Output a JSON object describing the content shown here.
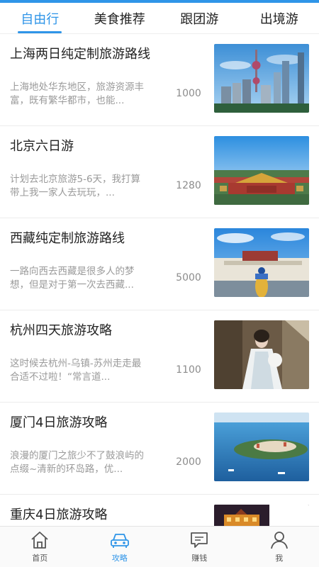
{
  "tabs": [
    {
      "label": "自由行",
      "active": true
    },
    {
      "label": "美食推荐",
      "active": false
    },
    {
      "label": "跟团游",
      "active": false
    },
    {
      "label": "出境游",
      "active": false
    }
  ],
  "items": [
    {
      "title": "上海两日纯定制旅游路线",
      "desc": "上海地处华东地区，旅游资源丰富，既有繁华都市，也能...",
      "count": "1000",
      "image": "shanghai-skyline"
    },
    {
      "title": "北京六日游",
      "desc": "计划去北京旅游5-6天，我打算带上我一家人去玩玩，...",
      "count": "1280",
      "image": "forbidden-city"
    },
    {
      "title": "西藏纯定制旅游路线",
      "desc": "一路向西去西藏是很多人的梦想，但是对于第一次去西藏...",
      "count": "5000",
      "image": "potala-palace"
    },
    {
      "title": "杭州四天旅游攻略",
      "desc": "这时候去杭州-乌镇-苏州走走最合适不过啦！“常言道...",
      "count": "1100",
      "image": "hanfu-girl"
    },
    {
      "title": "厦门4日旅游攻略",
      "desc": "浪漫的厦门之旅少不了鼓浪屿的点缀~清新的环岛路，优...",
      "count": "2000",
      "image": "xiamen-island"
    },
    {
      "title": "重庆4日旅游攻略",
      "desc": "",
      "count": "",
      "image": "chongqing-night"
    }
  ],
  "bottom_nav": [
    {
      "label": "首页",
      "icon": "home-icon",
      "active": false
    },
    {
      "label": "攻略",
      "icon": "car-icon",
      "active": true
    },
    {
      "label": "赚钱",
      "icon": "chat-money-icon",
      "active": false
    },
    {
      "label": "我",
      "icon": "person-icon",
      "active": false
    }
  ],
  "colors": {
    "accent": "#2f95e8",
    "text": "#222222",
    "muted": "#9a9a9a"
  }
}
